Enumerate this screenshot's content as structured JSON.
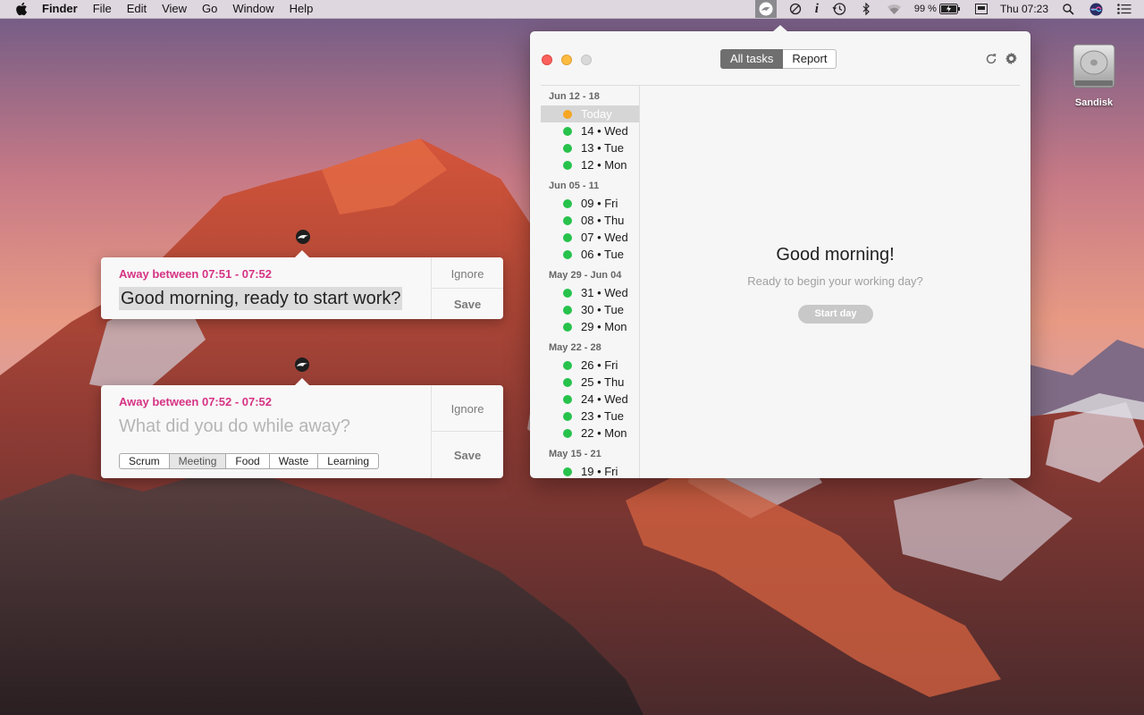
{
  "menubar": {
    "app_name": "Finder",
    "menus": [
      "File",
      "Edit",
      "View",
      "Go",
      "Window",
      "Help"
    ],
    "battery_percent": "99 %",
    "clock": "Thu 07:23",
    "status_icons": [
      "app-tracker-icon",
      "do-not-disturb-icon",
      "info-icon",
      "time-machine-icon",
      "bluetooth-icon",
      "wifi-icon",
      "battery-icon",
      "screen-icon",
      "spotlight-icon",
      "siri-icon",
      "notification-center-icon"
    ]
  },
  "desktop": {
    "disk_label": "Sandisk"
  },
  "window": {
    "tabs": [
      {
        "label": "All tasks",
        "active": true
      },
      {
        "label": "Report",
        "active": false
      }
    ],
    "sidebar_groups": [
      {
        "title": "Jun 12 - 18",
        "days": [
          {
            "label": "Today",
            "selected": true
          },
          {
            "label": "14 • Wed"
          },
          {
            "label": "13 • Tue"
          },
          {
            "label": "12 • Mon"
          }
        ]
      },
      {
        "title": "Jun 05 - 11",
        "days": [
          {
            "label": "09 • Fri"
          },
          {
            "label": "08 • Thu"
          },
          {
            "label": "07 • Wed"
          },
          {
            "label": "06 • Tue"
          }
        ]
      },
      {
        "title": "May 29 - Jun 04",
        "days": [
          {
            "label": "31 • Wed"
          },
          {
            "label": "30 • Tue"
          },
          {
            "label": "29 • Mon"
          }
        ]
      },
      {
        "title": "May 22 - 28",
        "days": [
          {
            "label": "26 • Fri"
          },
          {
            "label": "25 • Thu"
          },
          {
            "label": "24 • Wed"
          },
          {
            "label": "23 • Tue"
          },
          {
            "label": "22 • Mon"
          }
        ]
      },
      {
        "title": "May 15 - 21",
        "days": [
          {
            "label": "19 • Fri"
          }
        ]
      }
    ],
    "greeting": "Good morning!",
    "subtitle": "Ready to begin your working day?",
    "start_button": "Start day"
  },
  "notifications": [
    {
      "away": "Away between 07:51 - 07:52",
      "question": "Good morning, ready to start work?",
      "ignore": "Ignore",
      "save": "Save"
    },
    {
      "away": "Away between 07:52 - 07:52",
      "placeholder": "What did you do while away?",
      "ignore": "Ignore",
      "save": "Save",
      "tags": [
        "Scrum",
        "Meeting",
        "Food",
        "Waste",
        "Learning"
      ],
      "selected_tag": "Meeting"
    }
  ],
  "colors": {
    "accent_pink": "#d63384",
    "status_green": "#27c24c",
    "today_orange": "#f5a623"
  }
}
